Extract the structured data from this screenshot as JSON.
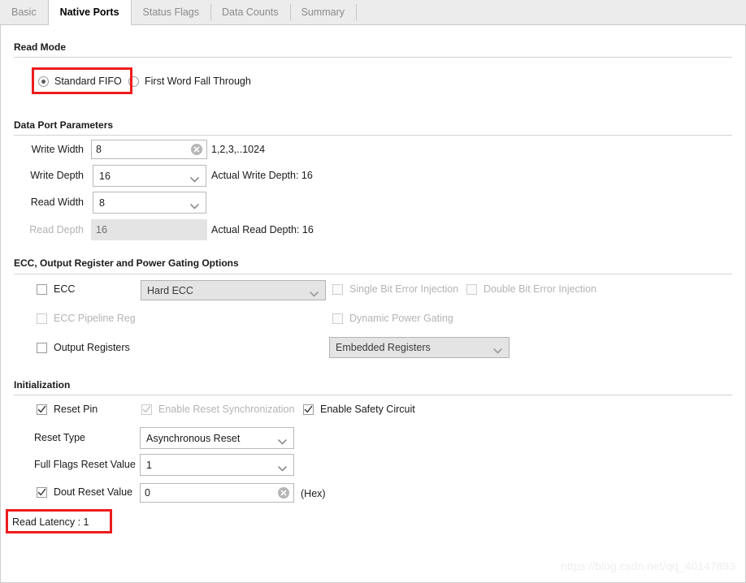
{
  "tabs": [
    {
      "label": "Basic",
      "active": false
    },
    {
      "label": "Native Ports",
      "active": true
    },
    {
      "label": "Status Flags",
      "active": false
    },
    {
      "label": "Data Counts",
      "active": false
    },
    {
      "label": "Summary",
      "active": false
    }
  ],
  "sections": {
    "read_mode": {
      "title": "Read Mode",
      "options": [
        {
          "label": "Standard FIFO",
          "selected": true
        },
        {
          "label": "First Word Fall Through",
          "selected": false
        }
      ]
    },
    "data_port": {
      "title": "Data Port Parameters",
      "write_width": {
        "label": "Write Width",
        "value": "8",
        "hint": "1,2,3,..1024"
      },
      "write_depth": {
        "label": "Write Depth",
        "value": "16",
        "hint": "Actual Write Depth: 16"
      },
      "read_width": {
        "label": "Read Width",
        "value": "8",
        "hint": ""
      },
      "read_depth": {
        "label": "Read Depth",
        "value": "16",
        "hint": "Actual Read Depth: 16"
      }
    },
    "ecc": {
      "title": "ECC, Output Register and Power Gating Options",
      "ecc_check": {
        "label": "ECC",
        "checked": false
      },
      "ecc_mode": {
        "value": "Hard ECC"
      },
      "single_bit": {
        "label": "Single Bit Error Injection",
        "checked": false
      },
      "double_bit": {
        "label": "Double Bit Error Injection",
        "checked": false
      },
      "ecc_pipeline": {
        "label": "ECC Pipeline Reg",
        "checked": false
      },
      "dynamic_power": {
        "label": "Dynamic Power Gating",
        "checked": false
      },
      "output_registers": {
        "label": "Output Registers",
        "checked": false
      },
      "register_type": {
        "value": "Embedded Registers"
      }
    },
    "initialization": {
      "title": "Initialization",
      "reset_pin": {
        "label": "Reset Pin",
        "checked": true
      },
      "reset_sync": {
        "label": "Enable Reset Synchronization",
        "checked": true
      },
      "safety_circuit": {
        "label": "Enable Safety Circuit",
        "checked": true
      },
      "reset_type": {
        "label": "Reset Type",
        "value": "Asynchronous Reset"
      },
      "full_flags": {
        "label": "Full Flags Reset Value",
        "value": "1"
      },
      "dout_reset": {
        "label": "Dout Reset Value",
        "checked": true,
        "value": "0",
        "hint": "(Hex)"
      }
    }
  },
  "read_latency": "Read Latency : 1",
  "watermark": "https://blog.csdn.net/qq_40147893",
  "colors": {
    "annotation": "#ee1c1c",
    "tab_bar": "#ececec",
    "border": "#cfcfcf"
  }
}
